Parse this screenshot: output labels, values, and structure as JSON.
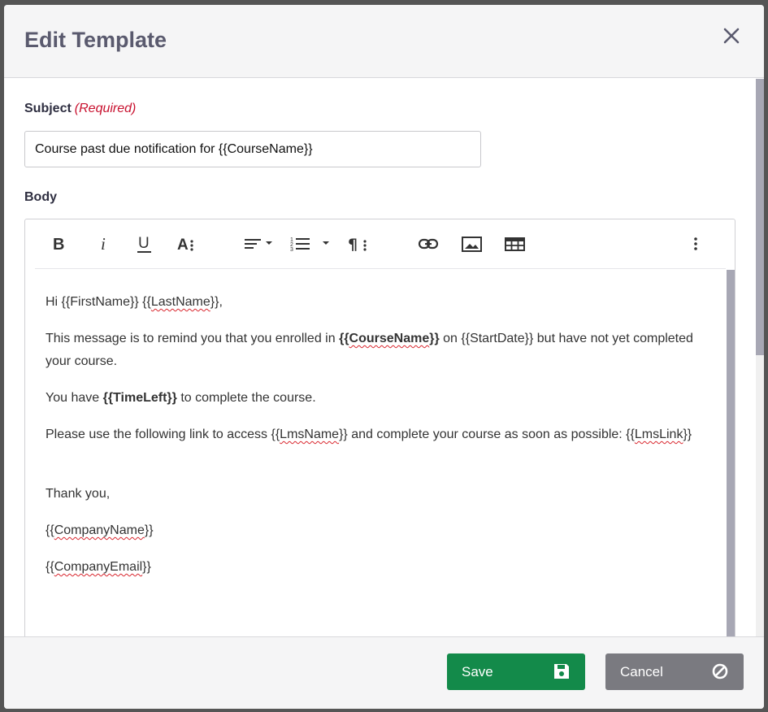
{
  "modal": {
    "title": "Edit Template",
    "close_icon": "close-icon"
  },
  "subject": {
    "label": "Subject",
    "required_text": "(Required)",
    "value": "Course past due notification for {{CourseName}}"
  },
  "body": {
    "label": "Body",
    "toolbar": [
      {
        "name": "bold-icon",
        "label": "B"
      },
      {
        "name": "italic-icon",
        "label": "i"
      },
      {
        "name": "underline-icon",
        "label": "U"
      },
      {
        "name": "font-size-icon",
        "label": "A:"
      },
      {
        "name": "align-dropdown-icon"
      },
      {
        "name": "ordered-list-dropdown-icon"
      },
      {
        "name": "paragraph-format-icon"
      },
      {
        "name": "link-icon"
      },
      {
        "name": "image-icon"
      },
      {
        "name": "table-icon"
      },
      {
        "name": "more-options-icon"
      }
    ],
    "content": {
      "greeting_prefix": "Hi {{FirstName}} {{",
      "greeting_name": "LastName",
      "greeting_suffix": "}},",
      "p1_a": "This message is to remind you that you enrolled in ",
      "p1_bold_a": "{{",
      "p1_bold_word": "CourseName",
      "p1_bold_b": "}}",
      "p1_b": " on {{StartDate}} but have not yet completed your course.",
      "p2_a": "You have ",
      "p2_bold": "{{TimeLeft}}",
      "p2_b": " to complete the course.",
      "p3_a": "Please use the following link to access {{",
      "p3_word1": "LmsName",
      "p3_b": "}} and complete your course as soon as possible: {{",
      "p3_word2": "LmsLink",
      "p3_c": "}}",
      "thanks": "Thank you,",
      "company_a": "{{",
      "company_word": "CompanyName",
      "company_b": "}}",
      "email_a": "{{",
      "email_word": "CompanyEmail",
      "email_b": "}}"
    }
  },
  "footer": {
    "save_label": "Save",
    "save_icon": "floppy-disk-icon",
    "cancel_label": "Cancel",
    "cancel_icon": "ban-icon"
  },
  "colors": {
    "save": "#138a4a",
    "cancel": "#7a7a80",
    "required": "#c8102e"
  }
}
